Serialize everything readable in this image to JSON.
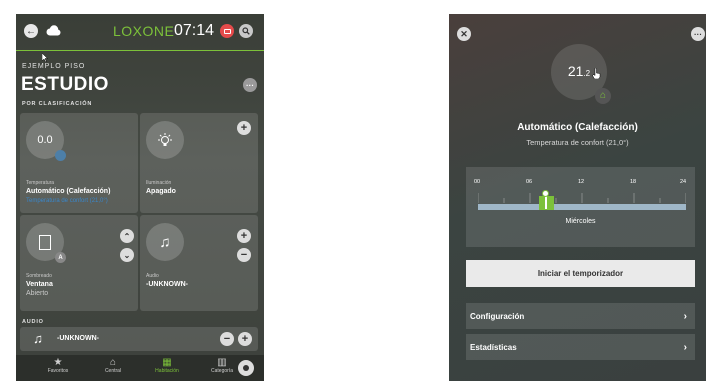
{
  "left": {
    "brand": "LOXONE",
    "time": "07:14",
    "location": "EJEMPLO PISO",
    "room": "ESTUDIO",
    "section_label": "POR CLASIFICACIÓN",
    "temp_card": {
      "value": "0.0",
      "label": "Temperatura",
      "mode": "Automático (Calefacción)",
      "sub": "Temperatura de confort (21,0°)"
    },
    "light_card": {
      "label": "Iluminación",
      "value": "Apagado"
    },
    "shade_card": {
      "badge": "A",
      "label": "Sombreado",
      "value": "Ventana",
      "sub": "Abierto"
    },
    "audio_card": {
      "label": "Audio",
      "value": "-UNKNOWN-"
    },
    "audio_section": "AUDIO",
    "audio_row": "-UNKNOWN-",
    "nav": [
      {
        "label": "Favoritos",
        "icon": "star-icon"
      },
      {
        "label": "Central",
        "icon": "home-icon"
      },
      {
        "label": "Habitación",
        "icon": "grid-icon"
      },
      {
        "label": "Categoría",
        "icon": "columns-icon"
      }
    ],
    "accent": "#7cc13a"
  },
  "right": {
    "temp_main": "21",
    "temp_dec": ".2",
    "mode": "Automático (Calefacción)",
    "comfort": "Temperatura de confort (21,0°)",
    "hours": [
      "00",
      "06",
      "12",
      "18",
      "24"
    ],
    "day": "Miércoles",
    "timer_button": "Iniciar el temporizador",
    "config": "Configuración",
    "stats": "Estadísticas"
  }
}
